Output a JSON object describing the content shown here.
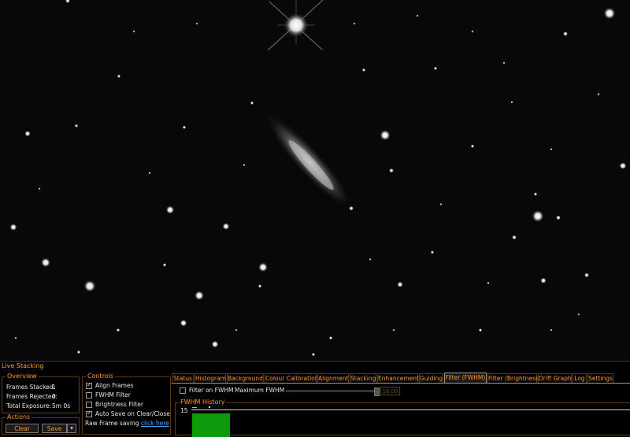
{
  "panel": {
    "title": "Live Stacking",
    "overview": {
      "title": "Overview",
      "rows": [
        {
          "label": "Frames Stacked:",
          "value": "1"
        },
        {
          "label": "Frames Rejected:",
          "value": "0"
        },
        {
          "label": "Total Exposure:",
          "value": "5m 0s"
        }
      ]
    },
    "actions": {
      "title": "Actions",
      "clear_label": "Clear",
      "save_label": "Save",
      "dropdown_icon": "chevron-down-icon"
    },
    "controls": {
      "title": "Controls",
      "items": [
        {
          "label": "Align Frames",
          "checked": true
        },
        {
          "label": "FWHM Filter",
          "checked": false
        },
        {
          "label": "Brightness Filter",
          "checked": false
        },
        {
          "label": "Auto Save on Clear/Close",
          "checked": true
        }
      ],
      "raw_frame_label": "Raw Frame saving",
      "raw_frame_link": "click here"
    },
    "tabs": [
      "Status",
      "Histogram",
      "Background",
      "Colour Calibration",
      "Alignment",
      "Stacking",
      "Enhancement",
      "Guiding",
      "Filter (FWHM)",
      "Filter (Brightness)",
      "Drift Graph",
      "Log",
      "Settings"
    ],
    "active_tab": "Filter (FWHM)",
    "fwhm_filter": {
      "checkbox_label": "Filter on FWHM",
      "checked": false,
      "max_label": "Maximum FWHM",
      "max_value": "16.00",
      "slider_fraction": 1.0,
      "history_title": "FWHM History",
      "history_y_tick": "15",
      "bar_color": "#0a9a0a"
    }
  },
  "colors": {
    "accent": "#ff9a2a",
    "link": "#4aa8ff"
  }
}
